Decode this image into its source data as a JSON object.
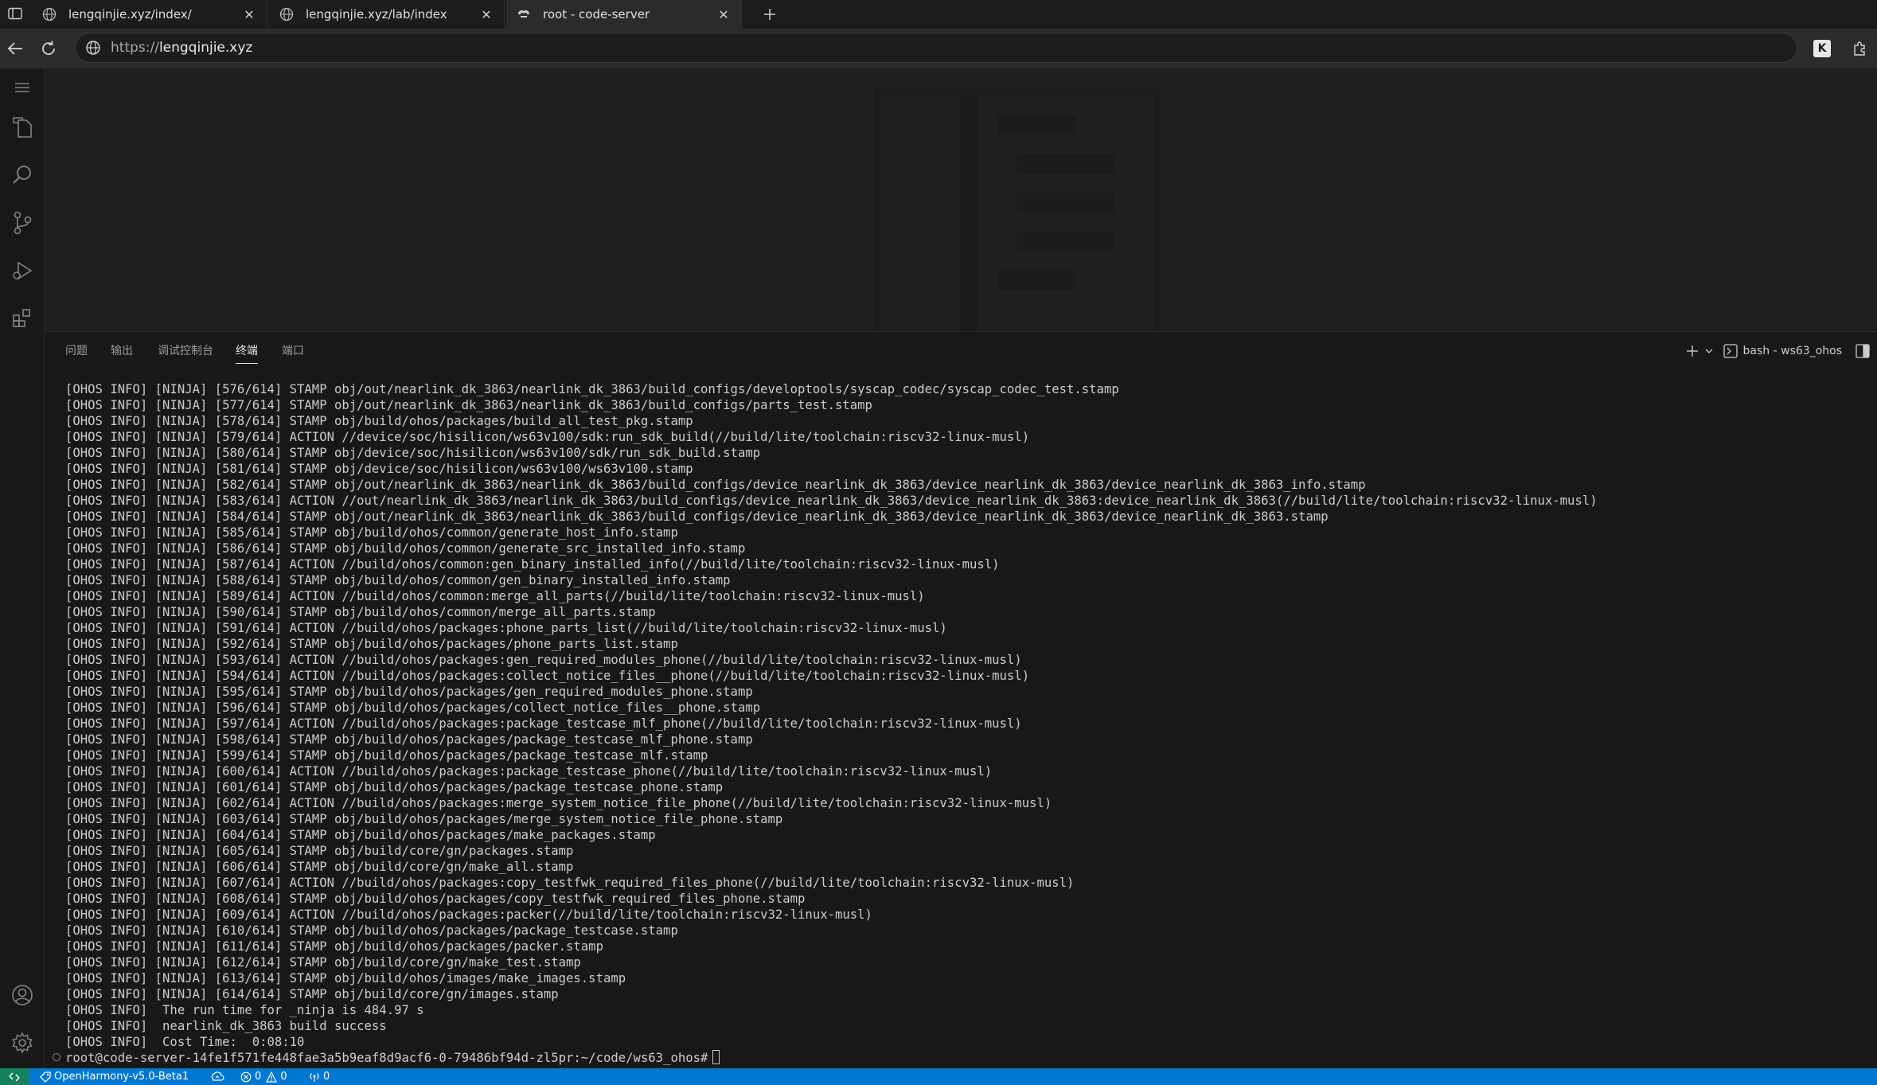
{
  "browser": {
    "tabs": [
      {
        "title": "lengqinjie.xyz/index/",
        "active": false,
        "favicon": "globe-icon"
      },
      {
        "title": "lengqinjie.xyz/lab/index",
        "active": false,
        "favicon": "globe-icon"
      },
      {
        "title": "root - code-server",
        "active": true,
        "favicon": "code-server-icon"
      }
    ],
    "close_glyph": "✕",
    "url_scheme": "https://",
    "url_host": "lengqinjie.xyz",
    "extension_label": "K"
  },
  "panel": {
    "tabs": [
      "问题",
      "输出",
      "调试控制台",
      "终端",
      "端口"
    ],
    "active_tab": "终端",
    "terminal_name": "bash - ws63_ohos"
  },
  "terminal": {
    "lines": [
      "[OHOS INFO] [NINJA] [576/614] STAMP obj/out/nearlink_dk_3863/nearlink_dk_3863/build_configs/developtools/syscap_codec/syscap_codec_test.stamp",
      "[OHOS INFO] [NINJA] [577/614] STAMP obj/out/nearlink_dk_3863/nearlink_dk_3863/build_configs/parts_test.stamp",
      "[OHOS INFO] [NINJA] [578/614] STAMP obj/build/ohos/packages/build_all_test_pkg.stamp",
      "[OHOS INFO] [NINJA] [579/614] ACTION //device/soc/hisilicon/ws63v100/sdk:run_sdk_build(//build/lite/toolchain:riscv32-linux-musl)",
      "[OHOS INFO] [NINJA] [580/614] STAMP obj/device/soc/hisilicon/ws63v100/sdk/run_sdk_build.stamp",
      "[OHOS INFO] [NINJA] [581/614] STAMP obj/device/soc/hisilicon/ws63v100/ws63v100.stamp",
      "[OHOS INFO] [NINJA] [582/614] STAMP obj/out/nearlink_dk_3863/nearlink_dk_3863/build_configs/device_nearlink_dk_3863/device_nearlink_dk_3863/device_nearlink_dk_3863_info.stamp",
      "[OHOS INFO] [NINJA] [583/614] ACTION //out/nearlink_dk_3863/nearlink_dk_3863/build_configs/device_nearlink_dk_3863/device_nearlink_dk_3863:device_nearlink_dk_3863(//build/lite/toolchain:riscv32-linux-musl)",
      "[OHOS INFO] [NINJA] [584/614] STAMP obj/out/nearlink_dk_3863/nearlink_dk_3863/build_configs/device_nearlink_dk_3863/device_nearlink_dk_3863/device_nearlink_dk_3863.stamp",
      "[OHOS INFO] [NINJA] [585/614] STAMP obj/build/ohos/common/generate_host_info.stamp",
      "[OHOS INFO] [NINJA] [586/614] STAMP obj/build/ohos/common/generate_src_installed_info.stamp",
      "[OHOS INFO] [NINJA] [587/614] ACTION //build/ohos/common:gen_binary_installed_info(//build/lite/toolchain:riscv32-linux-musl)",
      "[OHOS INFO] [NINJA] [588/614] STAMP obj/build/ohos/common/gen_binary_installed_info.stamp",
      "[OHOS INFO] [NINJA] [589/614] ACTION //build/ohos/common:merge_all_parts(//build/lite/toolchain:riscv32-linux-musl)",
      "[OHOS INFO] [NINJA] [590/614] STAMP obj/build/ohos/common/merge_all_parts.stamp",
      "[OHOS INFO] [NINJA] [591/614] ACTION //build/ohos/packages:phone_parts_list(//build/lite/toolchain:riscv32-linux-musl)",
      "[OHOS INFO] [NINJA] [592/614] STAMP obj/build/ohos/packages/phone_parts_list.stamp",
      "[OHOS INFO] [NINJA] [593/614] ACTION //build/ohos/packages:gen_required_modules_phone(//build/lite/toolchain:riscv32-linux-musl)",
      "[OHOS INFO] [NINJA] [594/614] ACTION //build/ohos/packages:collect_notice_files__phone(//build/lite/toolchain:riscv32-linux-musl)",
      "[OHOS INFO] [NINJA] [595/614] STAMP obj/build/ohos/packages/gen_required_modules_phone.stamp",
      "[OHOS INFO] [NINJA] [596/614] STAMP obj/build/ohos/packages/collect_notice_files__phone.stamp",
      "[OHOS INFO] [NINJA] [597/614] ACTION //build/ohos/packages:package_testcase_mlf_phone(//build/lite/toolchain:riscv32-linux-musl)",
      "[OHOS INFO] [NINJA] [598/614] STAMP obj/build/ohos/packages/package_testcase_mlf_phone.stamp",
      "[OHOS INFO] [NINJA] [599/614] STAMP obj/build/ohos/packages/package_testcase_mlf.stamp",
      "[OHOS INFO] [NINJA] [600/614] ACTION //build/ohos/packages:package_testcase_phone(//build/lite/toolchain:riscv32-linux-musl)",
      "[OHOS INFO] [NINJA] [601/614] STAMP obj/build/ohos/packages/package_testcase_phone.stamp",
      "[OHOS INFO] [NINJA] [602/614] ACTION //build/ohos/packages:merge_system_notice_file_phone(//build/lite/toolchain:riscv32-linux-musl)",
      "[OHOS INFO] [NINJA] [603/614] STAMP obj/build/ohos/packages/merge_system_notice_file_phone.stamp",
      "[OHOS INFO] [NINJA] [604/614] STAMP obj/build/ohos/packages/make_packages.stamp",
      "[OHOS INFO] [NINJA] [605/614] STAMP obj/build/core/gn/packages.stamp",
      "[OHOS INFO] [NINJA] [606/614] STAMP obj/build/core/gn/make_all.stamp",
      "[OHOS INFO] [NINJA] [607/614] ACTION //build/ohos/packages:copy_testfwk_required_files_phone(//build/lite/toolchain:riscv32-linux-musl)",
      "[OHOS INFO] [NINJA] [608/614] STAMP obj/build/ohos/packages/copy_testfwk_required_files_phone.stamp",
      "[OHOS INFO] [NINJA] [609/614] ACTION //build/ohos/packages:packer(//build/lite/toolchain:riscv32-linux-musl)",
      "[OHOS INFO] [NINJA] [610/614] STAMP obj/build/ohos/packages/package_testcase.stamp",
      "[OHOS INFO] [NINJA] [611/614] STAMP obj/build/ohos/packages/packer.stamp",
      "[OHOS INFO] [NINJA] [612/614] STAMP obj/build/core/gn/make_test.stamp",
      "[OHOS INFO] [NINJA] [613/614] STAMP obj/build/ohos/images/make_images.stamp",
      "[OHOS INFO] [NINJA] [614/614] STAMP obj/build/core/gn/images.stamp",
      "[OHOS INFO]  The run time for _ninja is 484.97 s",
      "[OHOS INFO]  nearlink_dk_3863 build success",
      "[OHOS INFO]  Cost Time:  0:08:10"
    ],
    "prompt": "root@code-server-14fe1f571fe448fae3a5b9eaf8d9acf6-0-79486bf94d-zl5pr:~/code/ws63_ohos#"
  },
  "statusbar": {
    "branch": "OpenHarmony-v5.0-Beta1",
    "errors": "0",
    "warnings": "0",
    "ports": "0"
  },
  "colors": {
    "status_bar": "#0078d4",
    "remote_indicator": "#16825d",
    "panel_bg": "#181818",
    "editor_bg": "#1f1f1f"
  }
}
